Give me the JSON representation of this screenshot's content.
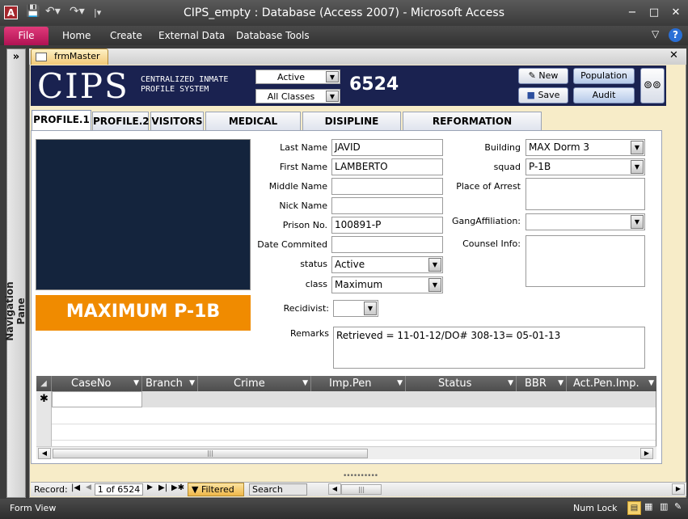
{
  "window": {
    "title": "CIPS_empty : Database (Access 2007)  -  Microsoft Access",
    "app_icon": "A",
    "minimize": "−",
    "maximize": "□",
    "close": "✕"
  },
  "ribbon": {
    "file": "File",
    "tabs": [
      "Home",
      "Create",
      "External Data",
      "Database Tools"
    ],
    "minimize_glyph": "▽",
    "help_glyph": "?"
  },
  "nav_pane": {
    "label": "Navigation Pane",
    "toggle": "»"
  },
  "doc_tab": {
    "label": "frmMaster",
    "close": "✕"
  },
  "header": {
    "logo": "CIPS",
    "subtitle_line1": "CENTRALIZED INMATE",
    "subtitle_line2": "PROFILE SYSTEM",
    "status_filter": "Active",
    "class_filter": "All Classes",
    "count": "6524",
    "new_label": "New",
    "save_label": "Save",
    "population_label": "Population",
    "audit_label": "Audit"
  },
  "tabs": [
    "PROFILE.1",
    "PROFILE.2",
    "VISITORS",
    "MEDICAL RECORD",
    "DISIPLINE RECORD",
    "REFORMATION PROGRAM"
  ],
  "profile": {
    "class_banner": "MAXIMUM P-1B",
    "labels": {
      "last_name": "Last Name",
      "first_name": "First Name",
      "middle_name": "Middle Name",
      "nick_name": "Nick Name",
      "prison_no": "Prison No.",
      "date_commited": "Date Commited",
      "status": "status",
      "class": "class",
      "recidivist": "Recidivist:",
      "remarks": "Remarks",
      "building": "Building",
      "squad": "squad",
      "place_of_arrest": "Place of Arrest",
      "gang": "GangAffiliation:",
      "counsel": "Counsel Info:"
    },
    "values": {
      "last_name": "JAVID",
      "first_name": "LAMBERTO",
      "middle_name": "",
      "nick_name": "",
      "prison_no": "100891-P",
      "date_commited": "",
      "status": "Active",
      "class": "Maximum",
      "recidivist": "",
      "remarks": "Retrieved = 11-01-12/DO# 308-13= 05-01-13",
      "building": "MAX Dorm 3",
      "squad": "P-1B",
      "place_of_arrest": "",
      "gang": "",
      "counsel": ""
    }
  },
  "grid": {
    "columns": [
      "CaseNo",
      "Branch",
      "Crime",
      "Imp.Pen",
      "Status",
      "BBR",
      "Act.Pen.Imp."
    ],
    "new_row_marker": "✱"
  },
  "record_nav": {
    "label": "Record:",
    "position": "1 of 6524",
    "filtered": "Filtered",
    "search": "Search"
  },
  "status_bar": {
    "view": "Form View",
    "num_lock": "Num Lock"
  }
}
